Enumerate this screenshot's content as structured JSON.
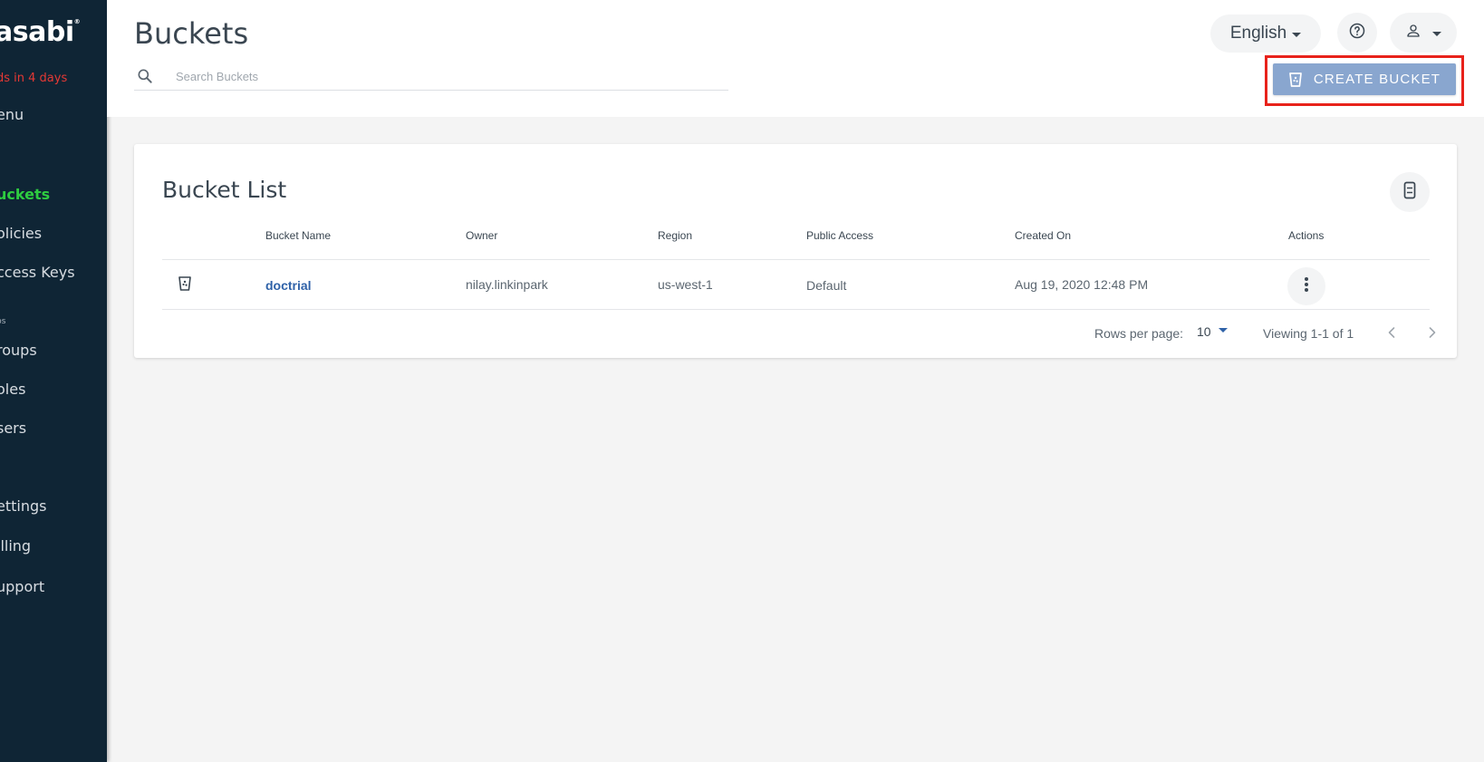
{
  "sidebar": {
    "logo": "asabi",
    "trial_notice": "ds in 4 days",
    "menu_label": "enu",
    "items": [
      {
        "label": "uckets",
        "active": true
      },
      {
        "label": "olicies"
      },
      {
        "label": "ccess Keys"
      },
      {
        "label": "ps",
        "section": true
      },
      {
        "label": "roups"
      },
      {
        "label": "oles"
      },
      {
        "label": "sers"
      },
      {
        "label": "ettings"
      },
      {
        "label": "illing"
      },
      {
        "label": "upport"
      }
    ]
  },
  "header": {
    "title": "Buckets",
    "search_placeholder": "Search Buckets",
    "language": "English",
    "create_label": "CREATE BUCKET"
  },
  "card": {
    "title": "Bucket List",
    "columns": [
      "Bucket Name",
      "Owner",
      "Region",
      "Public Access",
      "Created On",
      "Actions"
    ],
    "rows": [
      {
        "name": "doctrial",
        "owner": "nilay.linkinpark",
        "region": "us-west-1",
        "public_access": "Default",
        "created_on": "Aug 19, 2020 12:48 PM"
      }
    ],
    "rows_per_page_label": "Rows per page:",
    "rows_per_page": "10",
    "viewing": "Viewing 1-1 of 1"
  },
  "colors": {
    "sidebar_bg": "#0f2535",
    "active_nav": "#2ecc40",
    "trial_red": "#e53935",
    "primary_button": "#89a6cf",
    "link_blue": "#2f62a8",
    "highlight_red": "#e8221b"
  }
}
